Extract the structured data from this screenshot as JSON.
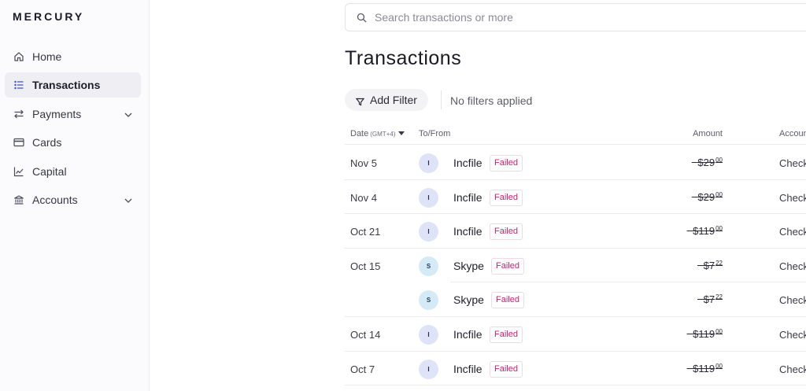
{
  "sidebar": {
    "logo": "MERCURY",
    "items": [
      {
        "label": "Home",
        "icon": "home-icon",
        "active": false,
        "chevron": false
      },
      {
        "label": "Transactions",
        "icon": "list-icon",
        "active": true,
        "chevron": false
      },
      {
        "label": "Payments",
        "icon": "arrows-swap-icon",
        "active": false,
        "chevron": true
      },
      {
        "label": "Cards",
        "icon": "credit-card-icon",
        "active": false,
        "chevron": false
      },
      {
        "label": "Capital",
        "icon": "chart-line-icon",
        "active": false,
        "chevron": false
      },
      {
        "label": "Accounts",
        "icon": "bank-icon",
        "active": false,
        "chevron": true
      }
    ]
  },
  "search": {
    "placeholder": "Search transactions or more"
  },
  "page": {
    "title": "Transactions"
  },
  "filters": {
    "add_label": "Add Filter",
    "status": "No filters applied"
  },
  "table": {
    "headers": {
      "date": "Date",
      "timezone": "(GMT+4)",
      "to_from": "To/From",
      "amount": "Amount",
      "account": "Account"
    },
    "rows": [
      {
        "date": "Nov 5",
        "initial": "I",
        "merchant": "Incfile",
        "status": "Failed",
        "amount_main": "−$29",
        "amount_cents": "00",
        "account": "Checking"
      },
      {
        "date": "Nov 4",
        "initial": "I",
        "merchant": "Incfile",
        "status": "Failed",
        "amount_main": "−$29",
        "amount_cents": "00",
        "account": "Checking"
      },
      {
        "date": "Oct 21",
        "initial": "I",
        "merchant": "Incfile",
        "status": "Failed",
        "amount_main": "−$119",
        "amount_cents": "00",
        "account": "Checking"
      },
      {
        "date": "Oct 15",
        "initial": "S",
        "merchant": "Skype",
        "status": "Failed",
        "amount_main": "−$7",
        "amount_cents": "22",
        "account": "Checking"
      },
      {
        "date": "",
        "initial": "S",
        "merchant": "Skype",
        "status": "Failed",
        "amount_main": "−$7",
        "amount_cents": "22",
        "account": "Checking"
      },
      {
        "date": "Oct 14",
        "initial": "I",
        "merchant": "Incfile",
        "status": "Failed",
        "amount_main": "−$119",
        "amount_cents": "00",
        "account": "Checking"
      },
      {
        "date": "Oct 7",
        "initial": "I",
        "merchant": "Incfile",
        "status": "Failed",
        "amount_main": "−$119",
        "amount_cents": "00",
        "account": "Checking"
      }
    ]
  },
  "colors": {
    "failed": "#c8246e",
    "avatar_incfile": "#dfe3f7",
    "avatar_skype": "#d4ebf7",
    "active_nav_bg": "#efeff3"
  }
}
